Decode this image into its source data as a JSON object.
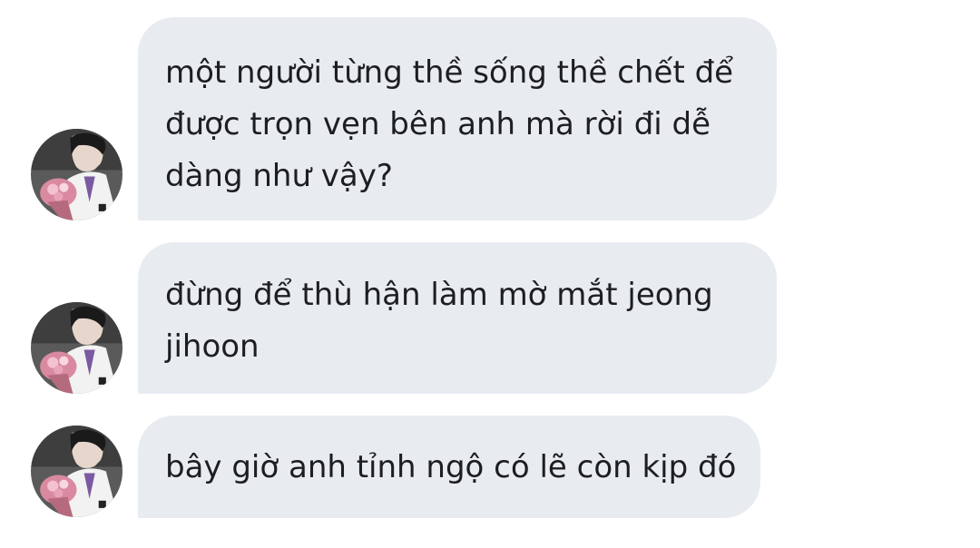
{
  "messages": [
    {
      "sender": "other",
      "lines": [
        "một người từng thề sống thề chết để",
        "được trọn vẹn bên anh mà rời đi dễ",
        "dàng như vậy?"
      ],
      "avatar": "profile-photo-icon"
    },
    {
      "sender": "other",
      "lines": [
        "đừng để thù hận làm mờ mắt jeong",
        "jihoon"
      ],
      "avatar": "profile-photo-icon"
    },
    {
      "sender": "other",
      "lines": [
        "bây giờ anh tỉnh ngộ có lẽ còn kịp đó"
      ],
      "avatar": "profile-photo-icon"
    }
  ],
  "colors": {
    "bubble": "#e8ecf1",
    "text": "#1c1e21",
    "background": "#ffffff"
  }
}
